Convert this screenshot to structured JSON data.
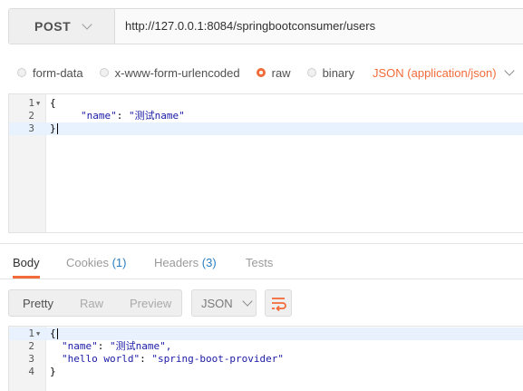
{
  "request": {
    "method": "POST",
    "url": "http://127.0.0.1:8084/springbootconsumer/users"
  },
  "body_types": {
    "options": [
      "form-data",
      "x-www-form-urlencoded",
      "raw",
      "binary"
    ],
    "selected": "raw",
    "content_type": "JSON (application/json)"
  },
  "request_body": {
    "lines": [
      "1",
      "2",
      "3"
    ],
    "open_brace": "{",
    "name_key": "\"name\"",
    "colon": ": ",
    "name_value": "\"测试name\"",
    "close_brace": "}"
  },
  "response_tabs": {
    "body": "Body",
    "cookies": "Cookies",
    "cookies_count": "(1)",
    "headers": "Headers",
    "headers_count": "(3)",
    "tests": "Tests"
  },
  "view_modes": {
    "pretty": "Pretty",
    "raw": "Raw",
    "preview": "Preview",
    "format": "JSON"
  },
  "response_body": {
    "lines": [
      "1",
      "2",
      "3",
      "4"
    ],
    "open_brace": "{",
    "name_key": "\"name\"",
    "name_value": "\"测试name\",",
    "hello_key": "\"hello world\"",
    "hello_value": "\"spring-boot-provider\"",
    "close_brace": "}"
  },
  "colors": {
    "accent": "#f26b3a",
    "count": "#2a7ec1",
    "json_string": "#1a1aa6"
  },
  "icons": [
    "chevron-down-icon",
    "wrap-lines-icon",
    "fold-arrow-icon"
  ]
}
